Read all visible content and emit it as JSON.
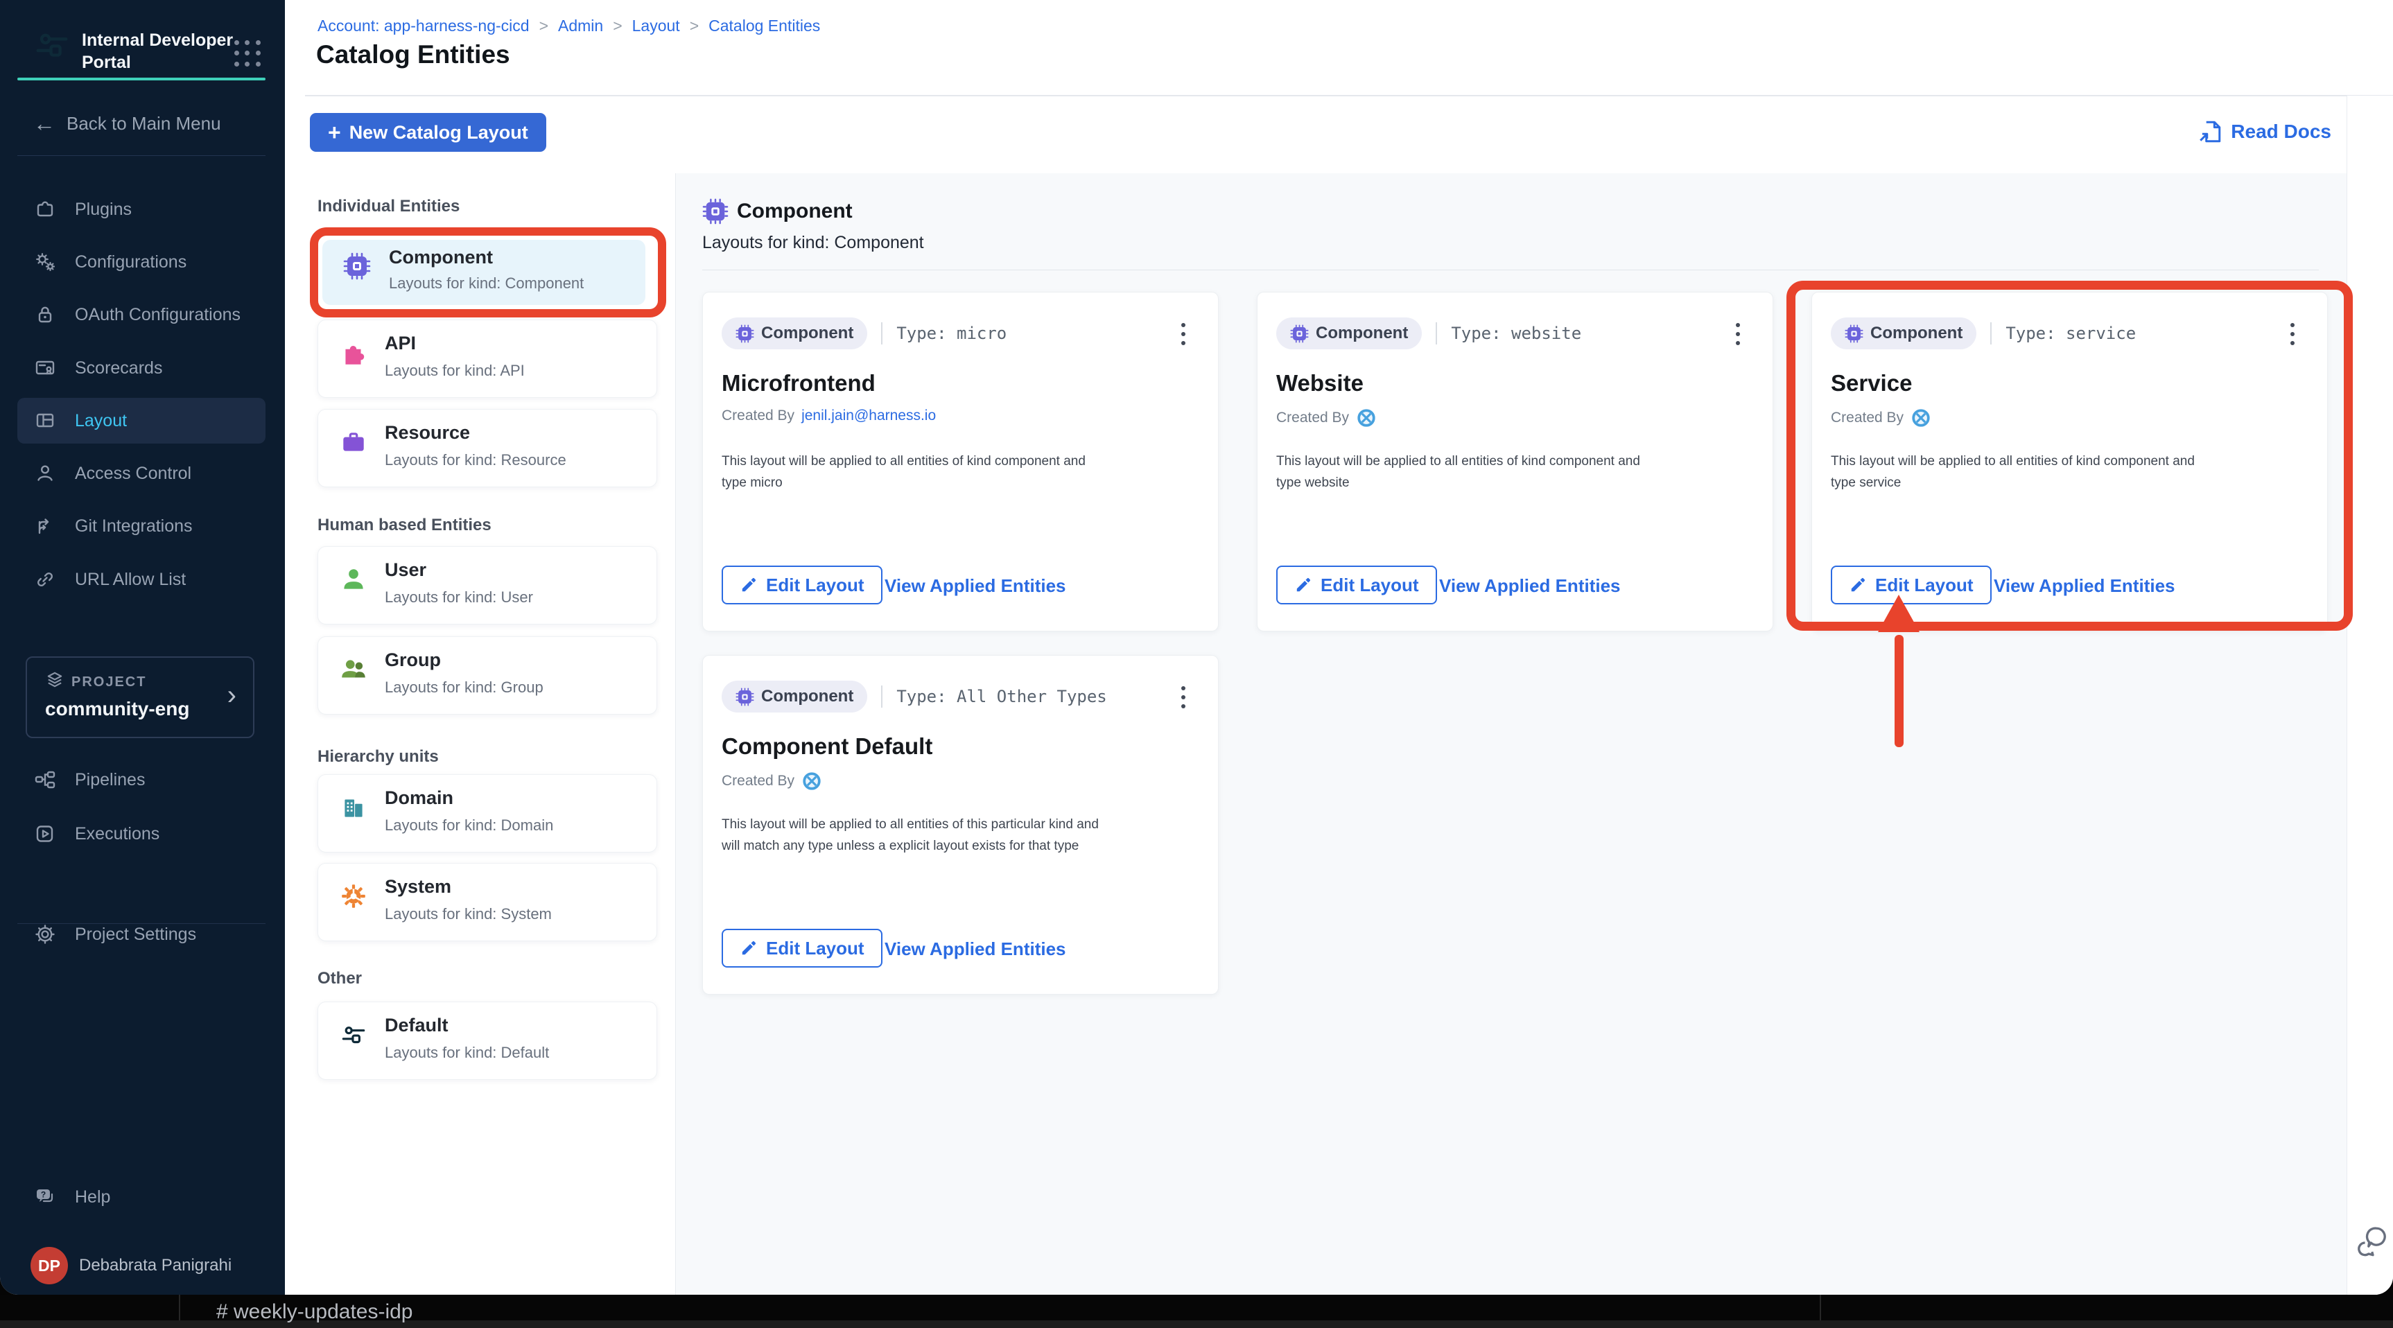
{
  "glyphs": {
    "plus": "+",
    "back_arrow": "←",
    "chevron_right": "›",
    "breadcrumb_sep": ">",
    "question": "?"
  },
  "colors": {
    "accent_blue": "#2b6be2",
    "button_blue": "#3568d4",
    "annotation_red": "#e8432c",
    "sidebar_bg": "#0c1c2f",
    "active_link": "#3fc6f2",
    "teal": "#3fd0b9",
    "avatar_red": "#c43d33"
  },
  "app": {
    "product_title": "Internal Developer Portal",
    "back_label": "Back to Main Menu"
  },
  "sidebar": {
    "nav": [
      {
        "label": "Plugins"
      },
      {
        "label": "Configurations"
      },
      {
        "label": "OAuth Configurations"
      },
      {
        "label": "Scorecards"
      },
      {
        "label": "Layout",
        "active": true
      },
      {
        "label": "Access Control"
      },
      {
        "label": "Git Integrations"
      },
      {
        "label": "URL Allow List"
      }
    ],
    "project_label": "PROJECT",
    "project_name": "community-eng",
    "nav_project": [
      {
        "label": "Pipelines"
      },
      {
        "label": "Executions"
      }
    ],
    "nav_settings": [
      {
        "label": "Project Settings"
      }
    ],
    "help_label": "Help",
    "user": {
      "initials": "DP",
      "name": "Debabrata Panigrahi"
    }
  },
  "header": {
    "breadcrumb": [
      "Account: app-harness-ng-cicd",
      "Admin",
      "Layout",
      "Catalog Entities"
    ],
    "title": "Catalog Entities"
  },
  "toolbar": {
    "new_button": "New Catalog Layout",
    "read_docs": "Read Docs"
  },
  "entity_panel": {
    "sections": [
      {
        "label": "Individual Entities",
        "items": [
          {
            "title": "Component",
            "desc": "Layouts for kind: Component",
            "selected": true
          },
          {
            "title": "API",
            "desc": "Layouts for kind: API"
          },
          {
            "title": "Resource",
            "desc": "Layouts for kind: Resource"
          }
        ]
      },
      {
        "label": "Human based Entities",
        "items": [
          {
            "title": "User",
            "desc": "Layouts for kind: User"
          },
          {
            "title": "Group",
            "desc": "Layouts for kind: Group"
          }
        ]
      },
      {
        "label": "Hierarchy units",
        "items": [
          {
            "title": "Domain",
            "desc": "Layouts for kind: Domain"
          },
          {
            "title": "System",
            "desc": "Layouts for kind: System"
          }
        ]
      },
      {
        "label": "Other",
        "items": [
          {
            "title": "Default",
            "desc": "Layouts for kind: Default"
          }
        ]
      }
    ]
  },
  "main": {
    "kind_title": "Component",
    "kind_subtitle": "Layouts for kind: Component",
    "cards": [
      {
        "badge": "Component",
        "type_label": "Type: micro",
        "title": "Microfrontend",
        "created_by_label": "Created By",
        "creator": "jenil.jain@harness.io",
        "description": "This layout will be applied to all entities of kind component and\ntype micro",
        "edit_label": "Edit Layout",
        "view_label": "View Applied Entities"
      },
      {
        "badge": "Component",
        "type_label": "Type: website",
        "title": "Website",
        "created_by_label": "Created By",
        "description": "This layout will be applied to all entities of kind component and\ntype website",
        "edit_label": "Edit Layout",
        "view_label": "View Applied Entities"
      },
      {
        "badge": "Component",
        "type_label": "Type: service",
        "title": "Service",
        "created_by_label": "Created By",
        "description": "This layout will be applied to all entities of kind component and\ntype service",
        "edit_label": "Edit Layout",
        "view_label": "View Applied Entities"
      },
      {
        "badge": "Component",
        "type_label": "Type: All Other Types",
        "title": "Component Default",
        "created_by_label": "Created By",
        "description": "This layout will be applied to all entities of this particular kind and\nwill match any type unless a explicit layout exists for that type",
        "edit_label": "Edit Layout",
        "view_label": "View Applied Entities"
      }
    ]
  },
  "overlay": {
    "slack_channel": "# weekly-updates-idp"
  }
}
